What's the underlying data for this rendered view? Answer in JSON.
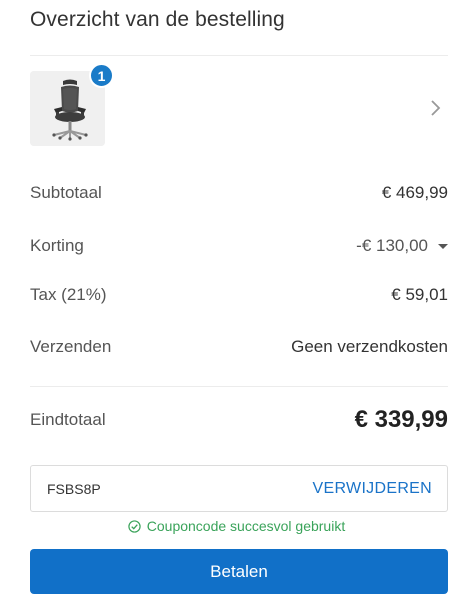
{
  "summary": {
    "title": "Overzicht van de bestelling"
  },
  "product": {
    "quantity": "1",
    "image_icon": "office-chair-image"
  },
  "totals": {
    "subtotal_label": "Subtotaal",
    "subtotal_value": "€ 469,99",
    "discount_label": "Korting",
    "discount_value": "-€ 130,00",
    "tax_label": "Tax (21%)",
    "tax_value": "€ 59,01",
    "shipping_label": "Verzenden",
    "shipping_value": "Geen verzendkosten",
    "total_label": "Eindtotaal",
    "total_value": "€ 339,99"
  },
  "coupon": {
    "code": "FSBS8P",
    "remove_label": "VERWIJDEREN",
    "success_message": "Couponcode succesvol gebruikt"
  },
  "actions": {
    "pay_label": "Betalen"
  },
  "colors": {
    "accent": "#1170c8",
    "badge": "#1a7bc8",
    "success": "#3aa35a"
  }
}
